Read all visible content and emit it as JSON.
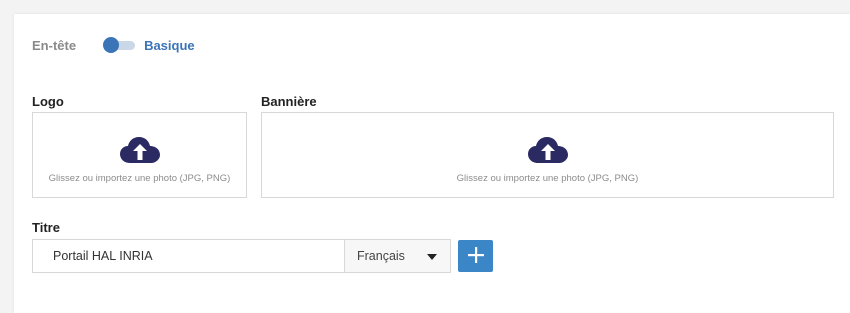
{
  "header": {
    "label": "En-tête",
    "toggle_label": "Basique",
    "toggle_on": false
  },
  "logo": {
    "label": "Logo",
    "hint": "Glissez ou importez une photo (JPG, PNG)",
    "icon": "cloud-upload-icon"
  },
  "banner": {
    "label": "Bannière",
    "hint": "Glissez ou importez une photo (JPG, PNG)",
    "icon": "cloud-upload-icon"
  },
  "title": {
    "label": "Titre",
    "value": "Portail HAL INRIA",
    "language": "Français",
    "add_icon": "plus-icon"
  },
  "colors": {
    "accent": "#3b75b8",
    "upload_icon": "#2c2a63",
    "add_button": "#3b86c6"
  }
}
